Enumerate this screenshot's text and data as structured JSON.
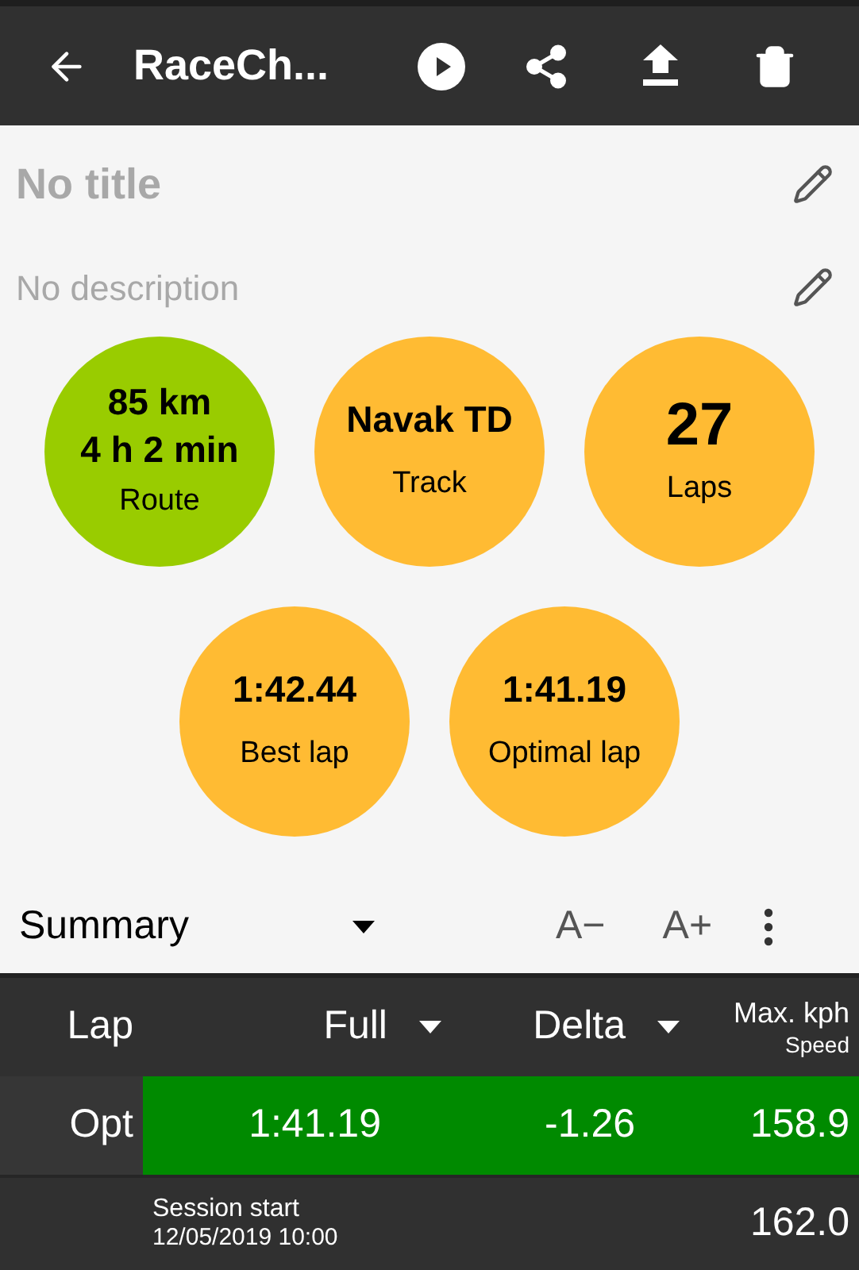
{
  "toolbar": {
    "title": "RaceCh..."
  },
  "header": {
    "title": "No title",
    "description": "No description"
  },
  "stats": [
    {
      "kind": "multi",
      "lines": [
        "85 km",
        "4 h 2 min"
      ],
      "label": "Route",
      "color": "#99cc00"
    },
    {
      "kind": "single",
      "lines": [
        "Navak TD"
      ],
      "label": "Track",
      "color": "#ffbb33"
    },
    {
      "kind": "large",
      "lines": [
        "27"
      ],
      "label": "Laps",
      "color": "#ffbb33"
    },
    {
      "kind": "single",
      "lines": [
        "1:42.44"
      ],
      "label": "Best lap",
      "color": "#ffbb33"
    },
    {
      "kind": "single",
      "lines": [
        "1:41.19"
      ],
      "label": "Optimal lap",
      "color": "#ffbb33"
    }
  ],
  "summary": {
    "selector": "Summary",
    "decrease": "A−",
    "increase": "A+"
  },
  "table": {
    "columns": [
      {
        "label": "Lap",
        "dropdown": false
      },
      {
        "label": "Full",
        "dropdown": true
      },
      {
        "label": "Delta",
        "dropdown": true
      },
      {
        "label": "Max. kph",
        "sublabel": "Speed",
        "dropdown": false
      }
    ],
    "rows": [
      {
        "kind": "lap",
        "selected": true,
        "lap": "Opt",
        "full": "1:41.19",
        "delta": "-1.26",
        "speed": "158.9"
      },
      {
        "kind": "session",
        "selected": false,
        "title": "Session start",
        "date": "12/05/2019 10:00",
        "speed": "162.0"
      }
    ]
  }
}
